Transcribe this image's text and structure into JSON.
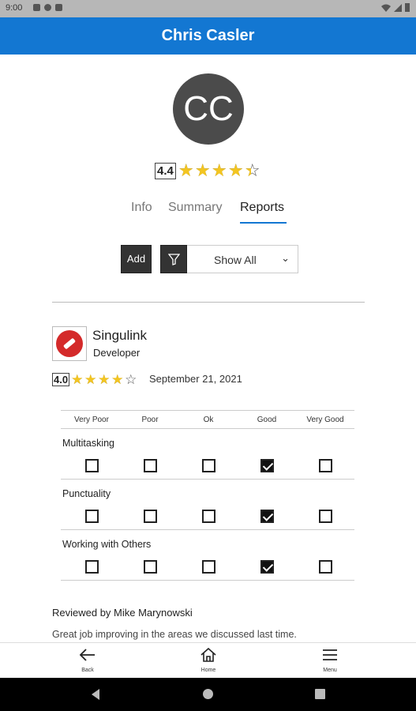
{
  "status": {
    "time": "9:00"
  },
  "title": "Chris Casler",
  "avatar_initials": "CC",
  "overall_rating": {
    "value": "4.4",
    "stars": 4.4
  },
  "tabs": [
    {
      "label": "Info",
      "active": false
    },
    {
      "label": "Summary",
      "active": false
    },
    {
      "label": "Reports",
      "active": true
    }
  ],
  "controls": {
    "add_label": "Add",
    "filter_value": "Show All"
  },
  "report": {
    "company": "Singulink",
    "role": "Developer",
    "rating": {
      "value": "4.0",
      "stars": 4.0
    },
    "date": "September 21, 2021",
    "scale": [
      "Very Poor",
      "Poor",
      "Ok",
      "Good",
      "Very Good"
    ],
    "criteria": [
      {
        "label": "Multitasking",
        "selected": 3
      },
      {
        "label": "Punctuality",
        "selected": 3
      },
      {
        "label": "Working with Others",
        "selected": 3
      }
    ],
    "reviewed_by": "Reviewed by Mike Marynowski",
    "comment": "Great job improving in the areas we discussed last time."
  },
  "bottom_nav": [
    {
      "label": "Back",
      "icon": "arrow-left-icon"
    },
    {
      "label": "Home",
      "icon": "home-icon"
    },
    {
      "label": "Menu",
      "icon": "hamburger-icon"
    }
  ],
  "colors": {
    "accent": "#1377d2",
    "star": "#f3c521",
    "logo": "#d42a2a"
  }
}
